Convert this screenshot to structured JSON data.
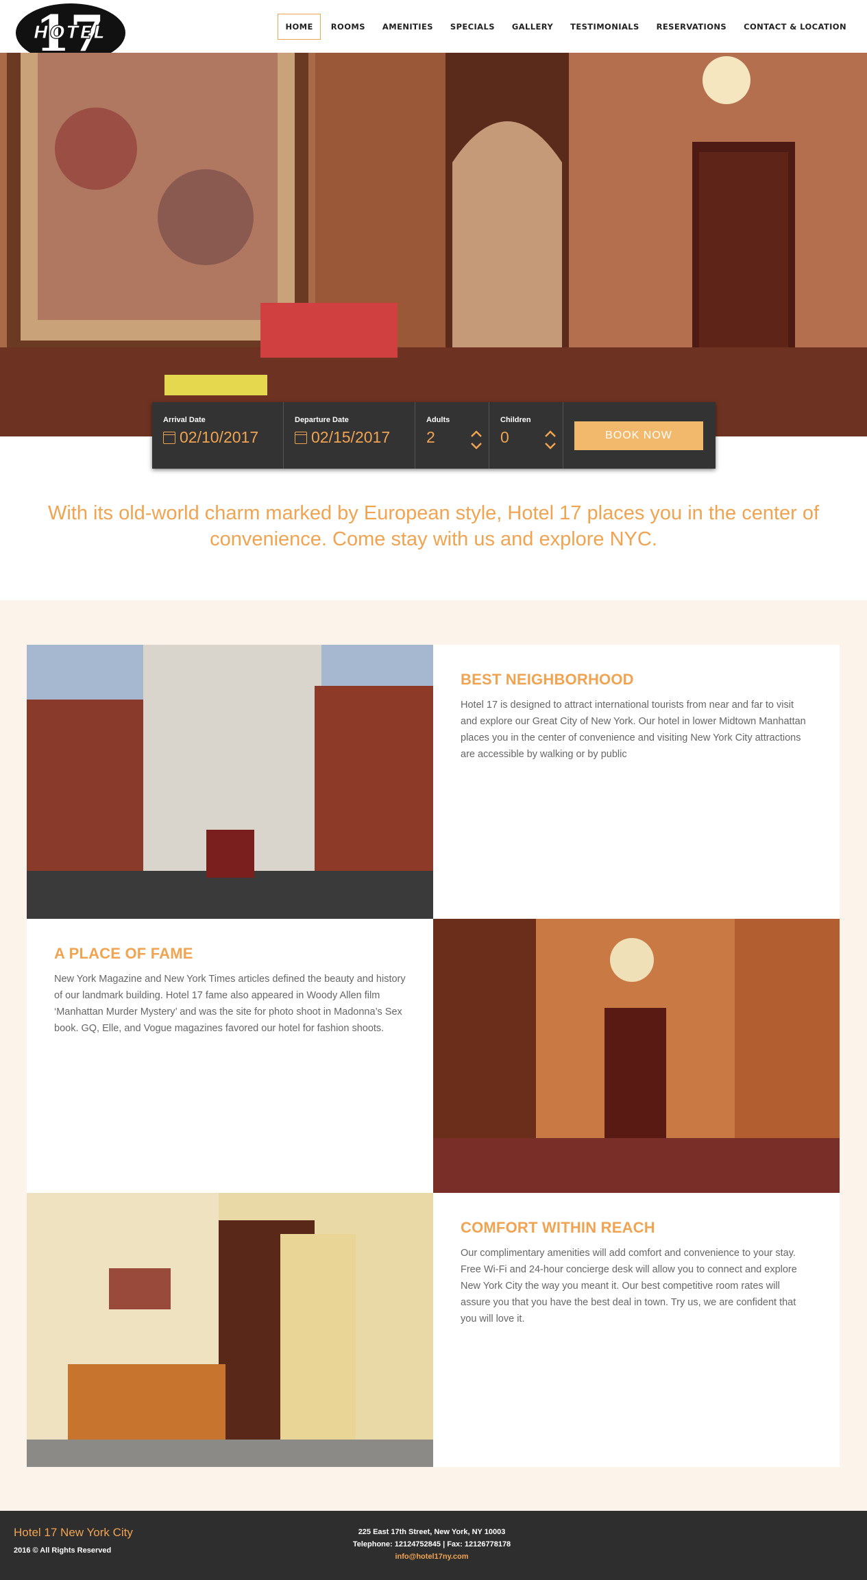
{
  "header": {
    "logo_text": "HOTEL",
    "logo_number": "17",
    "nav": [
      {
        "label": "HOME",
        "active": true
      },
      {
        "label": "ROOMS"
      },
      {
        "label": "AMENITIES"
      },
      {
        "label": "SPECIALS"
      },
      {
        "label": "GALLERY"
      },
      {
        "label": "TESTIMONIALS"
      },
      {
        "label": "RESERVATIONS"
      },
      {
        "label": "CONTACT & LOCATION"
      }
    ]
  },
  "booking": {
    "arrival_label": "Arrival Date",
    "arrival_value": "02/10/2017",
    "departure_label": "Departure Date",
    "departure_value": "02/15/2017",
    "adults_label": "Adults",
    "adults_value": "2",
    "children_label": "Children",
    "children_value": "0",
    "book_label": "BOOK NOW"
  },
  "intro": "With its old-world charm marked by European style, Hotel 17 places you in the center of convenience. Come stay with us and explore NYC.",
  "features": [
    {
      "title": "BEST NEIGHBORHOOD",
      "body": "Hotel 17 is designed to attract international tourists from near and far to visit and explore our Great City of New York. Our hotel in lower Midtown Manhattan places you in the center of convenience and visiting New York City attractions are accessible by walking or by public"
    },
    {
      "title": "A PLACE OF FAME",
      "body": "New York Magazine and New York Times articles defined the beauty and history of our landmark building. Hotel 17 fame also appeared in Woody Allen film ‘Manhattan Murder Mystery’ and was the site for photo shoot in Madonna’s Sex book. GQ, Elle, and Vogue magazines favored our hotel for fashion shoots."
    },
    {
      "title": "COMFORT WITHIN REACH",
      "body": "Our complimentary amenities will add comfort and convenience to your stay. Free Wi-Fi and 24-hour concierge desk will allow you to connect and explore New York City the way you meant it. Our best competitive room rates will assure you that you have the best deal in town. Try us, we are confident that you will love it."
    }
  ],
  "footer": {
    "title": "Hotel 17 New York City",
    "copyright": "2016 © All Rights Reserved",
    "address": "225 East 17th Street, New York, NY 10003",
    "phone": "Telephone: 12124752845 | Fax: 12126778178",
    "email": "info@hotel17ny.com"
  },
  "colors": {
    "accent": "#f0a452",
    "booking_bg": "#333333",
    "section_bg": "#fcf4ea",
    "footer_bg": "#2e2e2e"
  }
}
